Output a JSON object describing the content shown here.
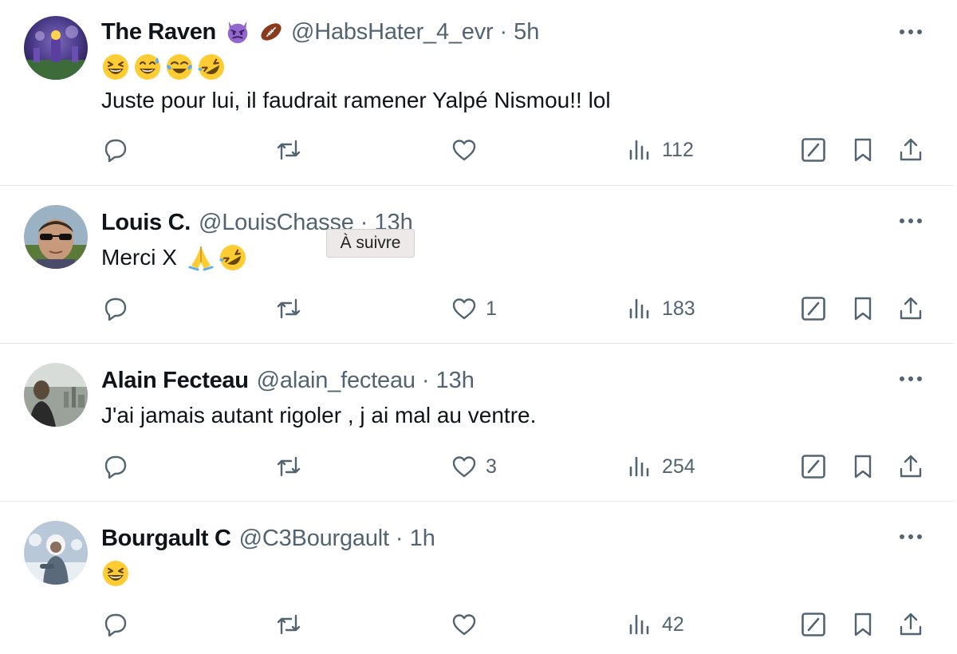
{
  "tweets": [
    {
      "name": "The Raven",
      "badges": [
        "smiling-devil-emoji",
        "american-football-emoji"
      ],
      "handle": "@HabsHater_4_evr",
      "separator": "·",
      "time": "5h",
      "emoji_line": [
        "laughing-emoji",
        "sweat-smile-emoji",
        "tears-of-joy-emoji",
        "rofl-emoji"
      ],
      "text": "Juste pour lui, il faudrait ramener Yalpé Nismou!! lol",
      "text_emojis": [],
      "reply_count": "",
      "retweet_count": "",
      "like_count": "",
      "view_count": "112"
    },
    {
      "name": "Louis C.",
      "badges": [],
      "handle": "@LouisChasse",
      "separator": "·",
      "time": "13h",
      "emoji_line": [],
      "text": "Merci X",
      "text_emojis": [
        "folded-hands-emoji",
        "rofl-emoji"
      ],
      "reply_count": "",
      "retweet_count": "",
      "like_count": "1",
      "view_count": "183"
    },
    {
      "name": "Alain Fecteau",
      "badges": [],
      "handle": "@alain_fecteau",
      "separator": "·",
      "time": "13h",
      "emoji_line": [],
      "text": "J'ai jamais autant rigoler , j ai mal au ventre.",
      "text_emojis": [],
      "reply_count": "",
      "retweet_count": "",
      "like_count": "3",
      "view_count": "254"
    },
    {
      "name": "Bourgault C",
      "badges": [],
      "handle": "@C3Bourgault",
      "separator": "·",
      "time": "1h",
      "emoji_line": [
        "laughing-emoji"
      ],
      "text": "",
      "text_emojis": [],
      "reply_count": "",
      "retweet_count": "",
      "like_count": "",
      "view_count": "42"
    }
  ],
  "tooltip": {
    "text": "À suivre"
  },
  "colors": {
    "text_primary": "#0f1419",
    "text_secondary": "#536471",
    "divider": "#e6e9ea",
    "background": "#ffffff",
    "tooltip_bg": "#ece9e8"
  },
  "icons": {
    "reply": "reply-icon",
    "retweet": "retweet-icon",
    "like": "heart-icon",
    "views": "views-chart-icon",
    "grok": "grok-icon",
    "bookmark": "bookmark-icon",
    "share": "share-icon",
    "more": "more-options-icon"
  }
}
